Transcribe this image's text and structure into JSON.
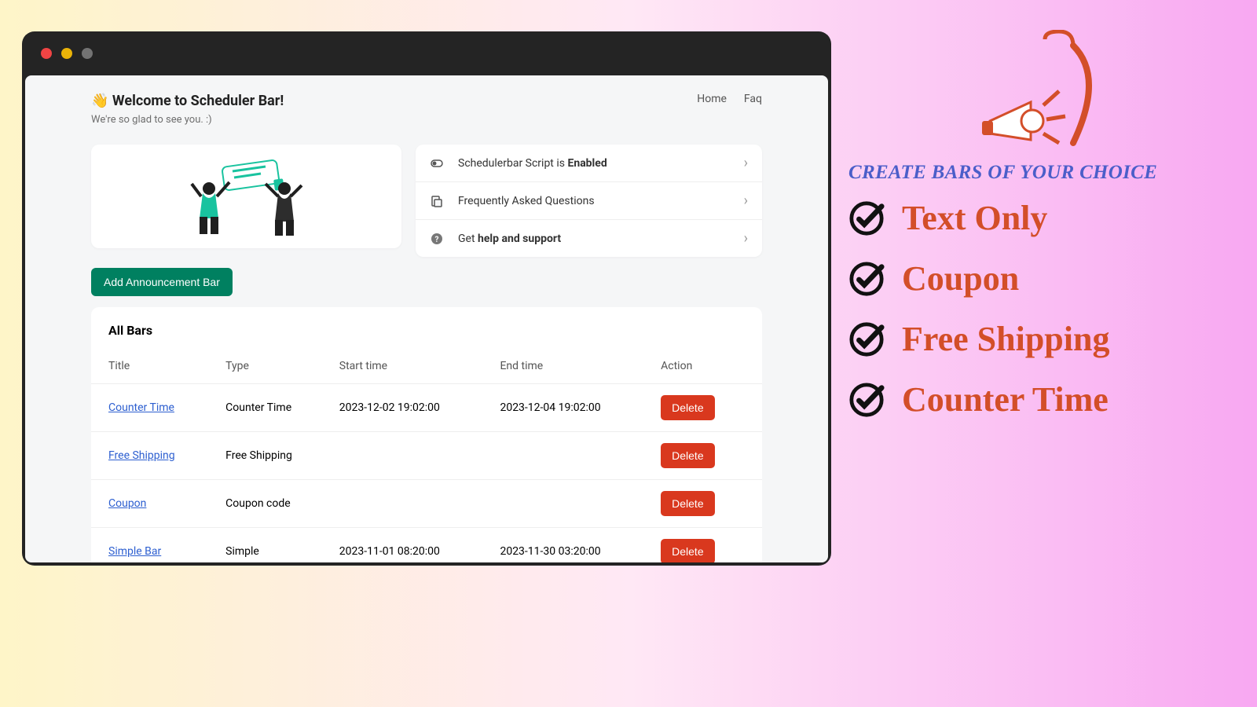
{
  "header": {
    "title": "👋 Welcome to Scheduler Bar!",
    "subtitle": "We're so glad to see you. :)",
    "nav": {
      "home": "Home",
      "faq": "Faq"
    }
  },
  "quicklinks": {
    "script_prefix": "Schedulerbar Script is ",
    "script_status": "Enabled",
    "faq": "Frequently Asked Questions",
    "help_prefix": "Get ",
    "help_bold": "help and support"
  },
  "buttons": {
    "add_bar": "Add Announcement Bar",
    "delete": "Delete"
  },
  "table": {
    "title": "All Bars",
    "columns": {
      "title": "Title",
      "type": "Type",
      "start": "Start time",
      "end": "End time",
      "action": "Action"
    },
    "rows": [
      {
        "title": "Counter Time",
        "type": "Counter Time",
        "start": "2023-12-02 19:02:00",
        "end": "2023-12-04 19:02:00"
      },
      {
        "title": "Free Shipping",
        "type": "Free Shipping",
        "start": "",
        "end": ""
      },
      {
        "title": "Coupon",
        "type": "Coupon code",
        "start": "",
        "end": ""
      },
      {
        "title": "Simple Bar",
        "type": "Simple",
        "start": "2023-11-01 08:20:00",
        "end": "2023-11-30 03:20:00"
      }
    ]
  },
  "promo": {
    "heading": "CREATE BARS OF YOUR CHOICE",
    "features": [
      "Text Only",
      "Coupon",
      "Free Shipping",
      "Counter Time"
    ]
  }
}
